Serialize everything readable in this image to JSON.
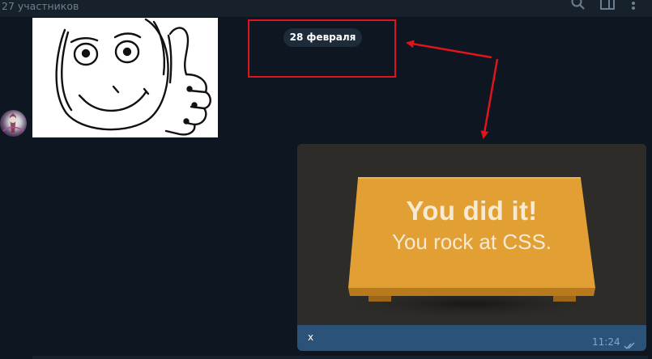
{
  "header": {
    "subtitle": "27 участников",
    "icons": [
      "search-icon",
      "columns-icon",
      "more-icon"
    ]
  },
  "chat": {
    "date_separator": "28 февраля",
    "incoming": {
      "sticker": "thumbs-up-rage-face-sticker",
      "avatar": "user-avatar"
    },
    "outgoing": {
      "image_title": "You did it!",
      "image_subtitle": "You rock at CSS.",
      "text": "x",
      "time": "11:24",
      "status_icon": "double-check-icon"
    }
  },
  "annotations": {
    "highlight_color": "#e0141b"
  },
  "colors": {
    "background": "#0e1621",
    "header": "#17212b",
    "bubble_out": "#2b5278",
    "date_pill": "#1e2c3a",
    "plate": "#e2a034"
  }
}
